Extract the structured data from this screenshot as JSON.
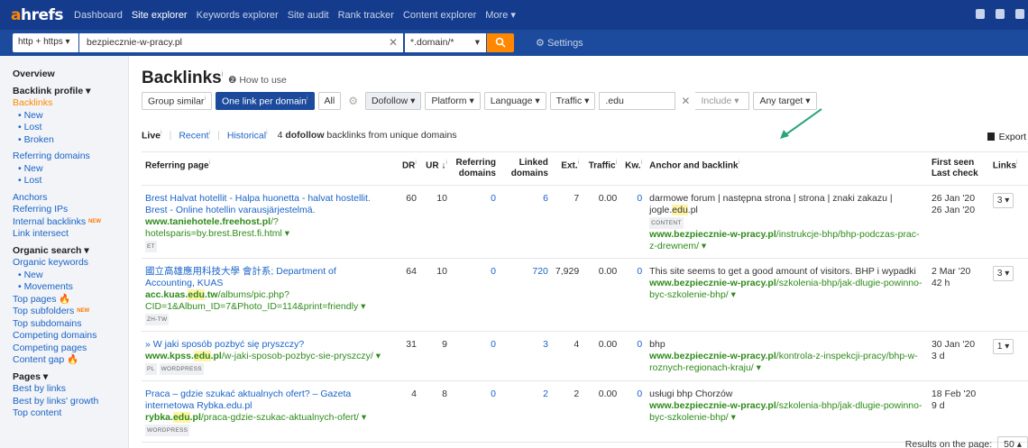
{
  "topnav": {
    "logo_a": "a",
    "logo_rest": "hrefs",
    "items": [
      "Dashboard",
      "Site explorer",
      "Keywords explorer",
      "Site audit",
      "Rank tracker",
      "Content explorer",
      "More ▾"
    ]
  },
  "search": {
    "protocol": "http + https ▾",
    "url": "bezpiecznie-w-pracy.pl",
    "mode": "*.domain/*",
    "mode_caret": "▾",
    "settings": "Settings"
  },
  "sidebar": {
    "overview": "Overview",
    "backlink_profile": "Backlink profile ▾",
    "backlinks": "Backlinks",
    "backlinks_sub": [
      "New",
      "Lost",
      "Broken"
    ],
    "referring_domains": "Referring domains",
    "referring_domains_sub": [
      "New",
      "Lost"
    ],
    "anchors": "Anchors",
    "referring_ips": "Referring IPs",
    "internal_backlinks": "Internal backlinks",
    "new_badge": "NEW",
    "link_intersect": "Link intersect",
    "organic_search": "Organic search ▾",
    "organic_keywords": "Organic keywords",
    "organic_sub": [
      "New",
      "Movements"
    ],
    "top_pages": "Top pages",
    "top_subfolders": "Top subfolders",
    "top_subdomains": "Top subdomains",
    "competing_domains": "Competing domains",
    "competing_pages": "Competing pages",
    "content_gap": "Content gap",
    "pages": "Pages ▾",
    "best_by_links": "Best by links",
    "best_by_links_growth": "Best by links' growth",
    "top_content": "Top content"
  },
  "main": {
    "title": "Backlinks",
    "info_mark": "i",
    "how_to_use": "How to use",
    "filters": {
      "group_similar": "Group similar",
      "one_link": "One link per domain",
      "all": "All",
      "dofollow": "Dofollow ▾",
      "platform": "Platform ▾",
      "language": "Language ▾",
      "traffic": "Traffic ▾",
      "text_value": ".edu",
      "include": "Include ▾",
      "any_target": "Any target ▾"
    },
    "modebar": {
      "live": "Live",
      "recent": "Recent",
      "historical": "Historical",
      "summary_count": "4",
      "summary_bold": "dofollow",
      "summary_rest": "backlinks from unique domains"
    },
    "export": "Export",
    "columns": [
      "Referring page",
      "DR",
      "UR ↓",
      "Referring domains",
      "Linked domains",
      "Ext.",
      "Traffic",
      "Kw.",
      "Anchor and backlink",
      "First seen Last check",
      "Links"
    ],
    "rows": [
      {
        "title": "Brest Halvat hotellit - Halpa huonetta - halvat hostellit. Brest - Online hotellin varausjärjestelmä.",
        "url_bold": "www.taniehotele.freehost.pl",
        "url_rest": "/?hotelsparis=by.brest.Brest.fi.html ▾",
        "tags": [
          "ET"
        ],
        "dr": "60",
        "ur": "10",
        "ref_domains": "0",
        "linked_domains": "6",
        "ext": "7",
        "traffic": "0.00",
        "kw": "0",
        "anchor": "darmowe forum | następna strona | strona | znaki zakazu | jogle.edu.pl",
        "anchor_tag": "CONTENT",
        "backlink_bold": "www.bezpiecznie-w-pracy.pl",
        "backlink_rest": "/instrukcje-bhp/bhp-podczas-prac-z-drewnem/ ▾",
        "first_seen": "26 Jan '20",
        "last_check": "26 Jan '20",
        "links": "3 ▾"
      },
      {
        "title": "國立高雄應用科技大學 會計系; Department of Accounting, KUAS",
        "url_bold": "acc.kuas.edu.tw",
        "url_rest": "/albums/pic.php?CID=1&Album_ID=7&Photo_ID=114&print=friendly ▾",
        "tags": [
          "ZH-TW"
        ],
        "dr": "64",
        "ur": "10",
        "ref_domains": "0",
        "linked_domains": "720",
        "ext": "7,929",
        "traffic": "0.00",
        "kw": "0",
        "anchor": "This site seems to get a good amount of visitors. BHP i wypadki",
        "anchor_tag": "",
        "backlink_bold": "www.bezpiecznie-w-pracy.pl",
        "backlink_rest": "/szkolenia-bhp/jak-dlugie-powinno-byc-szkolenie-bhp/ ▾",
        "first_seen": "2 Mar '20",
        "last_check": "42 h",
        "links": "3 ▾"
      },
      {
        "title": "» W jaki sposób pozbyć się pryszczy?",
        "url_bold": "www.kpss.edu.pl",
        "url_rest": "/w-jaki-sposob-pozbyc-sie-pryszczy/ ▾",
        "tags": [
          "PL",
          "WORDPRESS"
        ],
        "dr": "31",
        "ur": "9",
        "ref_domains": "0",
        "linked_domains": "3",
        "ext": "4",
        "traffic": "0.00",
        "kw": "0",
        "anchor": "bhp",
        "anchor_tag": "",
        "backlink_bold": "www.bezpiecznie-w-pracy.pl",
        "backlink_rest": "/kontrola-z-inspekcji-pracy/bhp-w-roznych-regionach-kraju/ ▾",
        "first_seen": "30 Jan '20",
        "last_check": "3 d",
        "links": "1 ▾"
      },
      {
        "title": "Praca – gdzie szukać aktualnych ofert? – Gazeta internetowa Rybka.edu.pl",
        "url_bold": "rybka.edu.pl",
        "url_rest": "/praca-gdzie-szukac-aktualnych-ofert/ ▾",
        "tags": [
          "WORDPRESS"
        ],
        "dr": "4",
        "ur": "8",
        "ref_domains": "0",
        "linked_domains": "2",
        "ext": "2",
        "traffic": "0.00",
        "kw": "0",
        "anchor": "usługi bhp Chorzów",
        "anchor_tag": "",
        "backlink_bold": "www.bezpiecznie-w-pracy.pl",
        "backlink_rest": "/szkolenia-bhp/jak-dlugie-powinno-byc-szkolenie-bhp/ ▾",
        "first_seen": "18 Feb '20",
        "last_check": "9 d",
        "links": ""
      }
    ],
    "pager_label": "Results on the page:",
    "pager_value": "50 ▴"
  },
  "colors": {
    "nav_bg": "#153c8c",
    "accent": "#ff8800",
    "link": "#1a63c8",
    "url_green": "#2e8b1b"
  },
  "icons": [
    "search-icon",
    "gear-icon",
    "close-icon",
    "export-icon",
    "bell-icon",
    "fire-icon"
  ]
}
